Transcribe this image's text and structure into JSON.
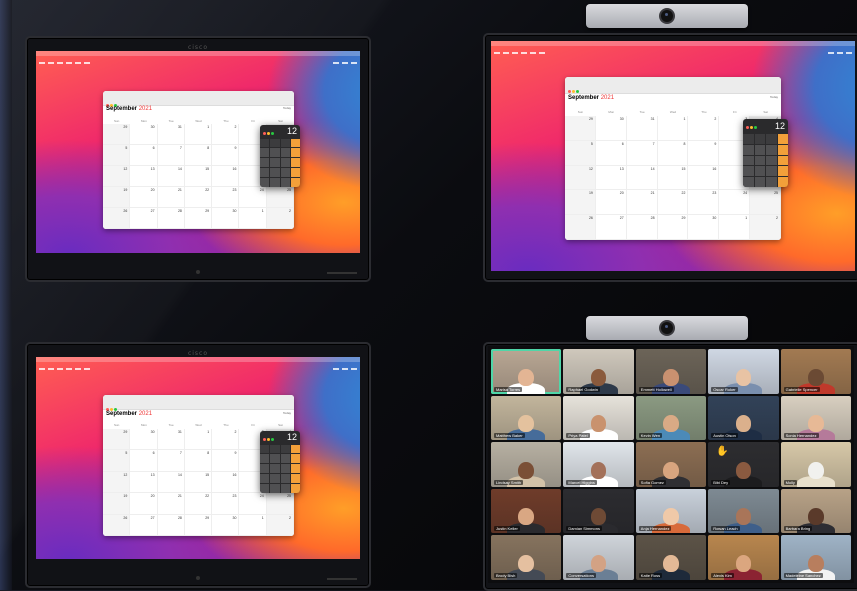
{
  "monitor": {
    "logo_text": "cisco"
  },
  "calendar": {
    "month": "September",
    "year": "2021",
    "today_label": "Today",
    "weekdays": [
      "Sun",
      "Mon",
      "Tue",
      "Wed",
      "Thu",
      "Fri",
      "Sat"
    ],
    "days": [
      "29",
      "30",
      "31",
      "1",
      "2",
      "3",
      "4",
      "5",
      "6",
      "7",
      "8",
      "9",
      "10",
      "11",
      "12",
      "13",
      "14",
      "15",
      "16",
      "17",
      "18",
      "19",
      "20",
      "21",
      "22",
      "23",
      "24",
      "25",
      "26",
      "27",
      "28",
      "29",
      "30",
      "1",
      "2"
    ]
  },
  "calculator": {
    "display": "12"
  },
  "colors": {
    "keypad_op": "#f2a03a",
    "active_speaker": "#4fd6a8"
  },
  "participants": [
    {
      "name": "Marisa Torres",
      "bg": "#b9a794",
      "skin": "#e3b594",
      "shirt": "#ffffff",
      "active": true
    },
    {
      "name": "Raphael Godwin",
      "bg": "#cfc8bc",
      "skin": "#8a5a3c",
      "shirt": "#2e3a4a"
    },
    {
      "name": "Emmett Hollowell",
      "bg": "#6c6458",
      "skin": "#c99170",
      "shirt": "#3a4a7a"
    },
    {
      "name": "Oscar Roker",
      "bg": "#cfd7e3",
      "skin": "#e8c3a4",
      "shirt": "#7a8fae"
    },
    {
      "name": "Gabrielle Spencer",
      "bg": "#a27a52",
      "skin": "#6b4a34",
      "shirt": "#c0392b"
    },
    {
      "name": "Matthew Baker",
      "bg": "#c2b59c",
      "skin": "#e4c29e",
      "shirt": "#466c9a"
    },
    {
      "name": "Priya Patel",
      "bg": "#e6e2da",
      "skin": "#c9926e",
      "shirt": "#ffffff"
    },
    {
      "name": "Kevin Wen",
      "bg": "#8b9a82",
      "skin": "#d9aa85",
      "shirt": "#4c8ab8"
    },
    {
      "name": "Austin Olson",
      "bg": "#324258",
      "skin": "#dbb08c",
      "shirt": "#1e2d44"
    },
    {
      "name": "Sonia Hernandez",
      "bg": "#d8cfc0",
      "skin": "#e7b996",
      "shirt": "#b57a9a"
    },
    {
      "name": "Lindsay Smith",
      "bg": "#b7b0a2",
      "skin": "#7a4f36",
      "shirt": "#d3c2a8"
    },
    {
      "name": "Marcel Higgins",
      "bg": "#e0e5ea",
      "skin": "#a3715a",
      "shirt": "#ffffff"
    },
    {
      "name": "Sofia Gomez",
      "bg": "#8c6e53",
      "skin": "#d8a57f",
      "shirt": "#2f2f33"
    },
    {
      "name": "Bibi Dey",
      "bg": "#2d2d30",
      "skin": "#8a5a40",
      "shirt": "#1c1c1e",
      "hand": true
    },
    {
      "name": "Molly",
      "bg": "#d7c8a8",
      "skin": "#f1f1ee",
      "shirt": "#e8e0cc"
    },
    {
      "name": "Justin Keller",
      "bg": "#6f3c2a",
      "skin": "#d9a783",
      "shirt": "#2a2a2e"
    },
    {
      "name": "Damian Simmons",
      "bg": "#2c2c30",
      "skin": "#6e4a35",
      "shirt": "#2a2a2e"
    },
    {
      "name": "Anja Hernandez",
      "bg": "#c9d1db",
      "skin": "#f0c9a8",
      "shirt": "#d86a3a"
    },
    {
      "name": "Rowan Leach",
      "bg": "#7e8a93",
      "skin": "#a97559",
      "shirt": "#3e5f8a"
    },
    {
      "name": "Barbara Bring",
      "bg": "#b8a287",
      "skin": "#5a3a2a",
      "shirt": "#2d2d33"
    },
    {
      "name": "Brody Bish",
      "bg": "#86735e",
      "skin": "#e5c0a0",
      "shirt": "#444a55"
    },
    {
      "name": "Conversations",
      "bg": "#cfd4da",
      "skin": "#d3a284",
      "shirt": "#6b7f95"
    },
    {
      "name": "Katie Ross",
      "bg": "#5c5347",
      "skin": "#e3b996",
      "shirt": "#1e2a3a"
    },
    {
      "name": "Alexis Kim",
      "bg": "#b8864e",
      "skin": "#dba67f",
      "shirt": "#8b2332"
    },
    {
      "name": "Madeleine Sanchez",
      "bg": "#9fb3c6",
      "skin": "#b87e5e",
      "shirt": "#f3f3f3"
    }
  ]
}
